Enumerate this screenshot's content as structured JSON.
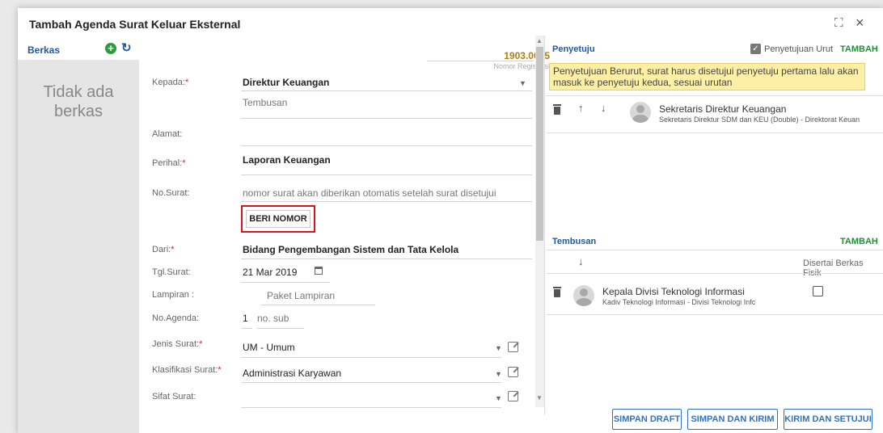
{
  "dialog": {
    "title": "Tambah Agenda Surat Keluar Eksternal"
  },
  "berkas": {
    "label": "Berkas",
    "empty_line1": "Tidak ada",
    "empty_line2": "berkas"
  },
  "registration": {
    "number": "1903.0035",
    "label": "Nomor Registrasi"
  },
  "form": {
    "kepada": {
      "label": "Kepada:",
      "value": "Direktur Keuangan"
    },
    "tembusan": {
      "placeholder": "Tembusan"
    },
    "alamat": {
      "label": "Alamat:"
    },
    "perihal": {
      "label": "Perihal:",
      "value": "Laporan Keuangan"
    },
    "no_surat": {
      "label": "No.Surat:",
      "value": "nomor surat akan diberikan otomatis setelah surat disetujui"
    },
    "beri_nomor": "BERI NOMOR",
    "dari": {
      "label": "Dari:",
      "value": "Bidang Pengembangan Sistem dan Tata Kelola"
    },
    "tgl_surat": {
      "label": "Tgl.Surat:",
      "value": "21 Mar 2019"
    },
    "lampiran": {
      "label": "Lampiran :",
      "placeholder": "Paket Lampiran"
    },
    "no_agenda": {
      "label": "No.Agenda:",
      "value": "1",
      "sub_placeholder": "no. sub"
    },
    "jenis_surat": {
      "label": "Jenis Surat:",
      "value": "UM - Umum"
    },
    "klasifikasi": {
      "label": "Klasifikasi Surat:",
      "value": "Administrasi Karyawan"
    },
    "sifat_surat": {
      "label": "Sifat Surat:"
    }
  },
  "penyetuju": {
    "label": "Penyetuju",
    "urut_label": "Penyetujuan Urut",
    "urut_checked": true,
    "add": "TAMBAH",
    "banner": "Penyetujuan Berurut, surat harus disetujui penyetuju pertama lalu akan masuk ke penyetuju kedua, sesuai urutan",
    "items": [
      {
        "name": "Sekretaris Direktur Keuangan",
        "detail": "Sekretaris Direktur SDM dan KEU (Double) - Direktorat Keuan"
      }
    ]
  },
  "tembusan_panel": {
    "label": "Tembusan",
    "add": "TAMBAH",
    "berkas_fisik": "Disertai Berkas Fisik",
    "items": [
      {
        "name": "Kepala Divisi Teknologi Informasi",
        "detail": "Kadiv Teknologi Informasi - Divisi Teknologi Infc"
      }
    ]
  },
  "buttons": {
    "draft": "SIMPAN DRAFT",
    "send": "SIMPAN DAN KIRIM",
    "approve": "KIRIM DAN SETUJUI"
  },
  "colors": {
    "accent": "#1f5aa0",
    "green": "#1d9138",
    "warning_bg": "#fdefa5",
    "highlight": "#d8131a"
  }
}
